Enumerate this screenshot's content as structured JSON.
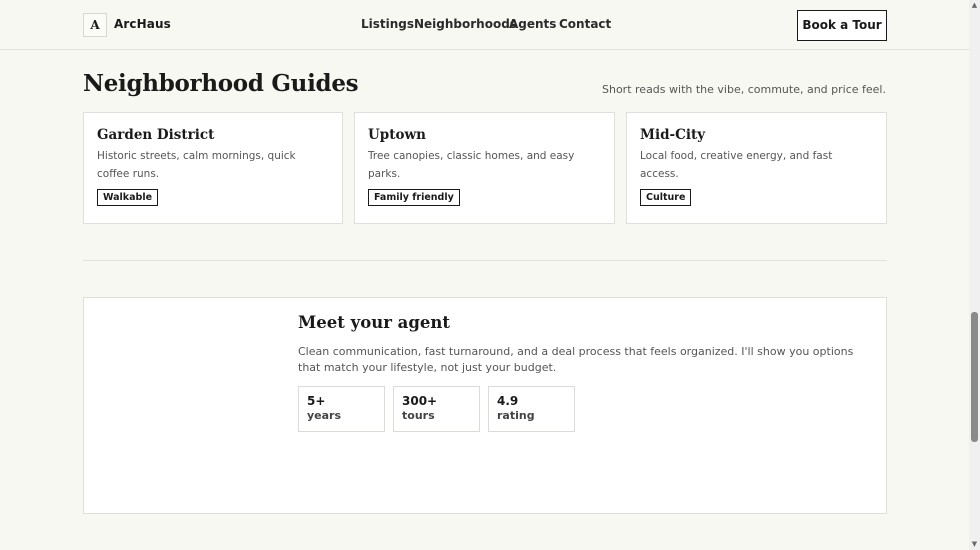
{
  "header": {
    "logo_letter": "A",
    "brand": "ArcHaus",
    "nav": [
      "Listings",
      "Neighborhoods",
      "Agents",
      "Contact"
    ],
    "cta": "Book a Tour"
  },
  "guides": {
    "title": "Neighborhood Guides",
    "subtitle": "Short reads with the vibe, commute, and price feel.",
    "cards": [
      {
        "title": "Garden District",
        "desc": "Historic streets, calm mornings, quick coffee runs.",
        "tag": "Walkable"
      },
      {
        "title": "Uptown",
        "desc": "Tree canopies, classic homes, and easy parks.",
        "tag": "Family friendly"
      },
      {
        "title": "Mid-City",
        "desc": "Local food, creative energy, and fast access.",
        "tag": "Culture"
      }
    ]
  },
  "agent": {
    "title": "Meet your agent",
    "body": "Clean communication, fast turnaround, and a deal process that feels organized. I'll show you options that match your lifestyle, not just your budget.",
    "stats": [
      {
        "value": "5+",
        "label": "years"
      },
      {
        "value": "300+",
        "label": "tours"
      },
      {
        "value": "4.9",
        "label": "rating"
      }
    ]
  },
  "scrollbar": {
    "up_icon": "▲",
    "down_icon": "▼"
  }
}
